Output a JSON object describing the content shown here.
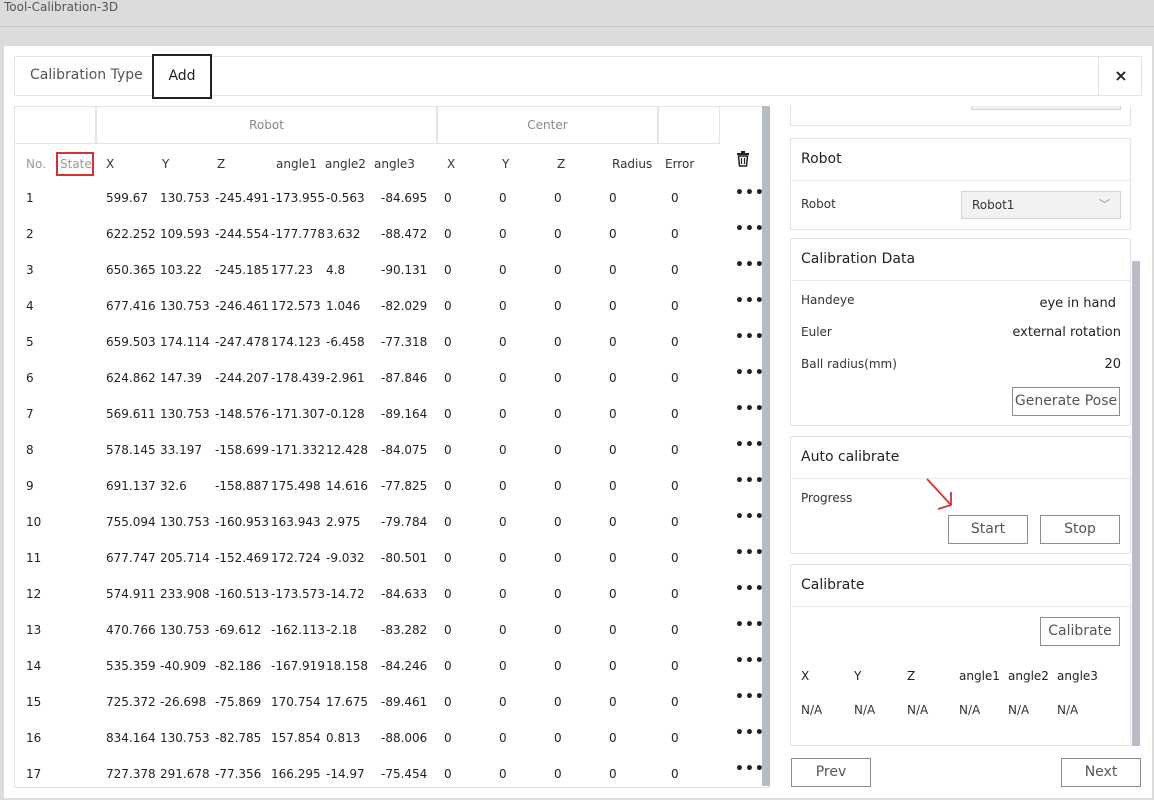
{
  "window": {
    "title": "Tool-Calibration-3D"
  },
  "tabs": {
    "calibration_type": "Calibration Type",
    "add": "Add",
    "close": "×"
  },
  "table": {
    "group_robot": "Robot",
    "group_center": "Center",
    "headers": {
      "no": "No.",
      "state": "State",
      "x": "X",
      "y": "Y",
      "z": "Z",
      "angle1": "angle1",
      "angle2": "angle2",
      "angle3": "angle3",
      "cx": "X",
      "cy": "Y",
      "cz": "Z",
      "radius": "Radius",
      "error": "Error"
    },
    "delete_icon": "trash-icon",
    "more_icon": "•••",
    "rows": [
      {
        "no": "1",
        "x": "599.67",
        "y": "130.753",
        "z": "-245.491",
        "a1": "-173.955",
        "a2": "-0.563",
        "a3": "-84.695",
        "cx": "0",
        "cy": "0",
        "cz": "0",
        "r": "0",
        "e": "0"
      },
      {
        "no": "2",
        "x": "622.252",
        "y": "109.593",
        "z": "-244.554",
        "a1": "-177.778",
        "a2": "3.632",
        "a3": "-88.472",
        "cx": "0",
        "cy": "0",
        "cz": "0",
        "r": "0",
        "e": "0"
      },
      {
        "no": "3",
        "x": "650.365",
        "y": "103.22",
        "z": "-245.185",
        "a1": "177.23",
        "a2": "4.8",
        "a3": "-90.131",
        "cx": "0",
        "cy": "0",
        "cz": "0",
        "r": "0",
        "e": "0"
      },
      {
        "no": "4",
        "x": "677.416",
        "y": "130.753",
        "z": "-246.461",
        "a1": "172.573",
        "a2": "1.046",
        "a3": "-82.029",
        "cx": "0",
        "cy": "0",
        "cz": "0",
        "r": "0",
        "e": "0"
      },
      {
        "no": "5",
        "x": "659.503",
        "y": "174.114",
        "z": "-247.478",
        "a1": "174.123",
        "a2": "-6.458",
        "a3": "-77.318",
        "cx": "0",
        "cy": "0",
        "cz": "0",
        "r": "0",
        "e": "0"
      },
      {
        "no": "6",
        "x": "624.862",
        "y": "147.39",
        "z": "-244.207",
        "a1": "-178.439",
        "a2": "-2.961",
        "a3": "-87.846",
        "cx": "0",
        "cy": "0",
        "cz": "0",
        "r": "0",
        "e": "0"
      },
      {
        "no": "7",
        "x": "569.611",
        "y": "130.753",
        "z": "-148.576",
        "a1": "-171.307",
        "a2": "-0.128",
        "a3": "-89.164",
        "cx": "0",
        "cy": "0",
        "cz": "0",
        "r": "0",
        "e": "0"
      },
      {
        "no": "8",
        "x": "578.145",
        "y": "33.197",
        "z": "-158.699",
        "a1": "-171.332",
        "a2": "12.428",
        "a3": "-84.075",
        "cx": "0",
        "cy": "0",
        "cz": "0",
        "r": "0",
        "e": "0"
      },
      {
        "no": "9",
        "x": "691.137",
        "y": "32.6",
        "z": "-158.887",
        "a1": "175.498",
        "a2": "14.616",
        "a3": "-77.825",
        "cx": "0",
        "cy": "0",
        "cz": "0",
        "r": "0",
        "e": "0"
      },
      {
        "no": "10",
        "x": "755.094",
        "y": "130.753",
        "z": "-160.953",
        "a1": "163.943",
        "a2": "2.975",
        "a3": "-79.784",
        "cx": "0",
        "cy": "0",
        "cz": "0",
        "r": "0",
        "e": "0"
      },
      {
        "no": "11",
        "x": "677.747",
        "y": "205.714",
        "z": "-152.469",
        "a1": "172.724",
        "a2": "-9.032",
        "a3": "-80.501",
        "cx": "0",
        "cy": "0",
        "cz": "0",
        "r": "0",
        "e": "0"
      },
      {
        "no": "12",
        "x": "574.911",
        "y": "233.908",
        "z": "-160.513",
        "a1": "-173.573",
        "a2": "-14.72",
        "a3": "-84.633",
        "cx": "0",
        "cy": "0",
        "cz": "0",
        "r": "0",
        "e": "0"
      },
      {
        "no": "13",
        "x": "470.766",
        "y": "130.753",
        "z": "-69.612",
        "a1": "-162.113",
        "a2": "-2.18",
        "a3": "-83.282",
        "cx": "0",
        "cy": "0",
        "cz": "0",
        "r": "0",
        "e": "0"
      },
      {
        "no": "14",
        "x": "535.359",
        "y": "-40.909",
        "z": "-82.186",
        "a1": "-167.919",
        "a2": "18.158",
        "a3": "-84.246",
        "cx": "0",
        "cy": "0",
        "cz": "0",
        "r": "0",
        "e": "0"
      },
      {
        "no": "15",
        "x": "725.372",
        "y": "-26.698",
        "z": "-75.869",
        "a1": "170.754",
        "a2": "17.675",
        "a3": "-89.461",
        "cx": "0",
        "cy": "0",
        "cz": "0",
        "r": "0",
        "e": "0"
      },
      {
        "no": "16",
        "x": "834.164",
        "y": "130.753",
        "z": "-82.785",
        "a1": "157.854",
        "a2": "0.813",
        "a3": "-88.006",
        "cx": "0",
        "cy": "0",
        "cz": "0",
        "r": "0",
        "e": "0"
      },
      {
        "no": "17",
        "x": "727.378",
        "y": "291.678",
        "z": "-77.356",
        "a1": "166.295",
        "a2": "-14.97",
        "a3": "-75.454",
        "cx": "0",
        "cy": "0",
        "cz": "0",
        "r": "0",
        "e": "0"
      }
    ]
  },
  "robot_card": {
    "title": "Robot",
    "label": "Robot",
    "selected": "Robot1"
  },
  "calib_data": {
    "title": "Calibration Data",
    "handeye_label": "Handeye",
    "handeye_value": "eye in hand",
    "euler_label": "Euler",
    "euler_value": "external rotation",
    "ball_label": "Ball radius(mm)",
    "ball_value": "20",
    "generate_btn": "Generate Pose"
  },
  "auto_calib": {
    "title": "Auto calibrate",
    "progress_label": "Progress",
    "start_btn": "Start",
    "stop_btn": "Stop"
  },
  "calibrate": {
    "title": "Calibrate",
    "btn": "Calibrate",
    "headers": [
      "X",
      "Y",
      "Z",
      "angle1",
      "angle2",
      "angle3"
    ],
    "values": [
      "N/A",
      "N/A",
      "N/A",
      "N/A",
      "N/A",
      "N/A"
    ]
  },
  "footer": {
    "prev": "Prev",
    "next": "Next"
  },
  "colors": {
    "highlight": "#d93030",
    "scrollbar": "#b7bcc7"
  }
}
